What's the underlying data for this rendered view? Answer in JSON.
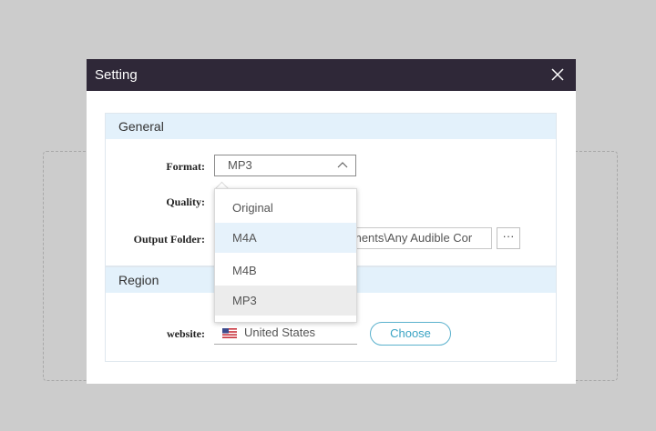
{
  "dialog": {
    "title": "Setting"
  },
  "general": {
    "header": "General",
    "format_label": "Format:",
    "format_value": "MP3",
    "quality_label": "Quality:",
    "output_folder_label": "Output Folder:",
    "output_folder_value": "ments\\Any Audible Cor",
    "more_label": "···"
  },
  "format_options": [
    {
      "label": "Original",
      "state": "normal"
    },
    {
      "label": "M4A",
      "state": "hover"
    },
    {
      "label": "M4B",
      "state": "normal"
    },
    {
      "label": "MP3",
      "state": "selected"
    }
  ],
  "region": {
    "header": "Region",
    "website_label": "website:",
    "country": "United States",
    "country_flag": "us-flag-icon",
    "choose_label": "Choose"
  },
  "colors": {
    "titlebar": "#2f2838",
    "section_header": "#e3f1fb",
    "hover_option": "#e6f2fb",
    "selected_option": "#ececec",
    "accent": "#3aa3c4"
  }
}
